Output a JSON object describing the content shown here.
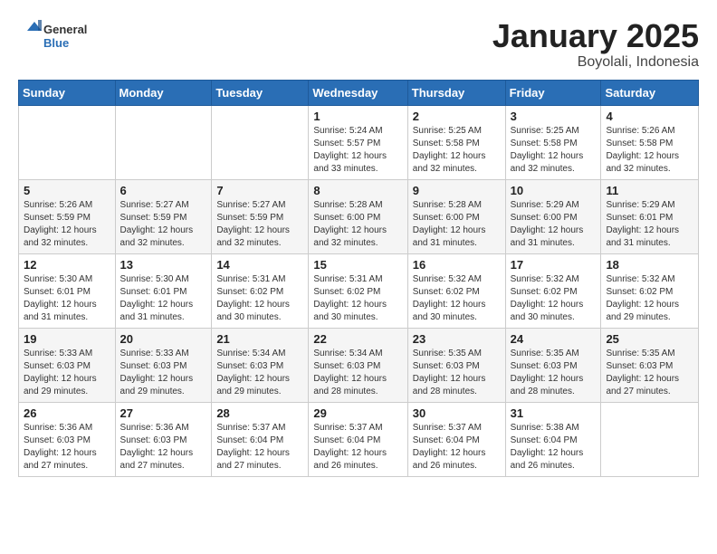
{
  "header": {
    "logo_general": "General",
    "logo_blue": "Blue",
    "month_title": "January 2025",
    "location": "Boyolali, Indonesia"
  },
  "weekdays": [
    "Sunday",
    "Monday",
    "Tuesday",
    "Wednesday",
    "Thursday",
    "Friday",
    "Saturday"
  ],
  "weeks": [
    [
      {
        "day": "",
        "sunrise": "",
        "sunset": "",
        "daylight": ""
      },
      {
        "day": "",
        "sunrise": "",
        "sunset": "",
        "daylight": ""
      },
      {
        "day": "",
        "sunrise": "",
        "sunset": "",
        "daylight": ""
      },
      {
        "day": "1",
        "sunrise": "Sunrise: 5:24 AM",
        "sunset": "Sunset: 5:57 PM",
        "daylight": "Daylight: 12 hours and 33 minutes."
      },
      {
        "day": "2",
        "sunrise": "Sunrise: 5:25 AM",
        "sunset": "Sunset: 5:58 PM",
        "daylight": "Daylight: 12 hours and 32 minutes."
      },
      {
        "day": "3",
        "sunrise": "Sunrise: 5:25 AM",
        "sunset": "Sunset: 5:58 PM",
        "daylight": "Daylight: 12 hours and 32 minutes."
      },
      {
        "day": "4",
        "sunrise": "Sunrise: 5:26 AM",
        "sunset": "Sunset: 5:58 PM",
        "daylight": "Daylight: 12 hours and 32 minutes."
      }
    ],
    [
      {
        "day": "5",
        "sunrise": "Sunrise: 5:26 AM",
        "sunset": "Sunset: 5:59 PM",
        "daylight": "Daylight: 12 hours and 32 minutes."
      },
      {
        "day": "6",
        "sunrise": "Sunrise: 5:27 AM",
        "sunset": "Sunset: 5:59 PM",
        "daylight": "Daylight: 12 hours and 32 minutes."
      },
      {
        "day": "7",
        "sunrise": "Sunrise: 5:27 AM",
        "sunset": "Sunset: 5:59 PM",
        "daylight": "Daylight: 12 hours and 32 minutes."
      },
      {
        "day": "8",
        "sunrise": "Sunrise: 5:28 AM",
        "sunset": "Sunset: 6:00 PM",
        "daylight": "Daylight: 12 hours and 32 minutes."
      },
      {
        "day": "9",
        "sunrise": "Sunrise: 5:28 AM",
        "sunset": "Sunset: 6:00 PM",
        "daylight": "Daylight: 12 hours and 31 minutes."
      },
      {
        "day": "10",
        "sunrise": "Sunrise: 5:29 AM",
        "sunset": "Sunset: 6:00 PM",
        "daylight": "Daylight: 12 hours and 31 minutes."
      },
      {
        "day": "11",
        "sunrise": "Sunrise: 5:29 AM",
        "sunset": "Sunset: 6:01 PM",
        "daylight": "Daylight: 12 hours and 31 minutes."
      }
    ],
    [
      {
        "day": "12",
        "sunrise": "Sunrise: 5:30 AM",
        "sunset": "Sunset: 6:01 PM",
        "daylight": "Daylight: 12 hours and 31 minutes."
      },
      {
        "day": "13",
        "sunrise": "Sunrise: 5:30 AM",
        "sunset": "Sunset: 6:01 PM",
        "daylight": "Daylight: 12 hours and 31 minutes."
      },
      {
        "day": "14",
        "sunrise": "Sunrise: 5:31 AM",
        "sunset": "Sunset: 6:02 PM",
        "daylight": "Daylight: 12 hours and 30 minutes."
      },
      {
        "day": "15",
        "sunrise": "Sunrise: 5:31 AM",
        "sunset": "Sunset: 6:02 PM",
        "daylight": "Daylight: 12 hours and 30 minutes."
      },
      {
        "day": "16",
        "sunrise": "Sunrise: 5:32 AM",
        "sunset": "Sunset: 6:02 PM",
        "daylight": "Daylight: 12 hours and 30 minutes."
      },
      {
        "day": "17",
        "sunrise": "Sunrise: 5:32 AM",
        "sunset": "Sunset: 6:02 PM",
        "daylight": "Daylight: 12 hours and 30 minutes."
      },
      {
        "day": "18",
        "sunrise": "Sunrise: 5:32 AM",
        "sunset": "Sunset: 6:02 PM",
        "daylight": "Daylight: 12 hours and 29 minutes."
      }
    ],
    [
      {
        "day": "19",
        "sunrise": "Sunrise: 5:33 AM",
        "sunset": "Sunset: 6:03 PM",
        "daylight": "Daylight: 12 hours and 29 minutes."
      },
      {
        "day": "20",
        "sunrise": "Sunrise: 5:33 AM",
        "sunset": "Sunset: 6:03 PM",
        "daylight": "Daylight: 12 hours and 29 minutes."
      },
      {
        "day": "21",
        "sunrise": "Sunrise: 5:34 AM",
        "sunset": "Sunset: 6:03 PM",
        "daylight": "Daylight: 12 hours and 29 minutes."
      },
      {
        "day": "22",
        "sunrise": "Sunrise: 5:34 AM",
        "sunset": "Sunset: 6:03 PM",
        "daylight": "Daylight: 12 hours and 28 minutes."
      },
      {
        "day": "23",
        "sunrise": "Sunrise: 5:35 AM",
        "sunset": "Sunset: 6:03 PM",
        "daylight": "Daylight: 12 hours and 28 minutes."
      },
      {
        "day": "24",
        "sunrise": "Sunrise: 5:35 AM",
        "sunset": "Sunset: 6:03 PM",
        "daylight": "Daylight: 12 hours and 28 minutes."
      },
      {
        "day": "25",
        "sunrise": "Sunrise: 5:35 AM",
        "sunset": "Sunset: 6:03 PM",
        "daylight": "Daylight: 12 hours and 27 minutes."
      }
    ],
    [
      {
        "day": "26",
        "sunrise": "Sunrise: 5:36 AM",
        "sunset": "Sunset: 6:03 PM",
        "daylight": "Daylight: 12 hours and 27 minutes."
      },
      {
        "day": "27",
        "sunrise": "Sunrise: 5:36 AM",
        "sunset": "Sunset: 6:03 PM",
        "daylight": "Daylight: 12 hours and 27 minutes."
      },
      {
        "day": "28",
        "sunrise": "Sunrise: 5:37 AM",
        "sunset": "Sunset: 6:04 PM",
        "daylight": "Daylight: 12 hours and 27 minutes."
      },
      {
        "day": "29",
        "sunrise": "Sunrise: 5:37 AM",
        "sunset": "Sunset: 6:04 PM",
        "daylight": "Daylight: 12 hours and 26 minutes."
      },
      {
        "day": "30",
        "sunrise": "Sunrise: 5:37 AM",
        "sunset": "Sunset: 6:04 PM",
        "daylight": "Daylight: 12 hours and 26 minutes."
      },
      {
        "day": "31",
        "sunrise": "Sunrise: 5:38 AM",
        "sunset": "Sunset: 6:04 PM",
        "daylight": "Daylight: 12 hours and 26 minutes."
      },
      {
        "day": "",
        "sunrise": "",
        "sunset": "",
        "daylight": ""
      }
    ]
  ]
}
